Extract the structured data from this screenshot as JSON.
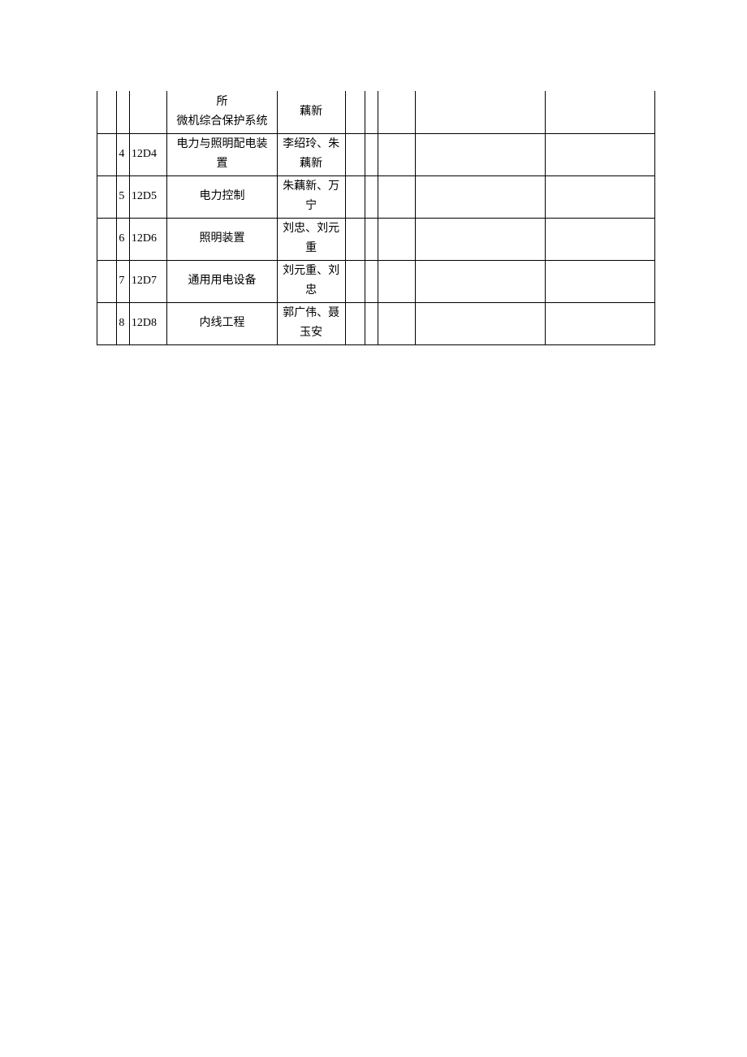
{
  "rows": [
    {
      "idx": "",
      "code": "",
      "name_line1": "所",
      "name_line2": "微机综合保护系统",
      "people": "藕新"
    },
    {
      "idx": "4",
      "code": "12D4",
      "name_line1": "电力与照明配电装",
      "name_line2": "置",
      "people": "李绍玲、朱藕新"
    },
    {
      "idx": "5",
      "code": "12D5",
      "name_line1": "电力控制",
      "name_line2": "",
      "people": "朱藕新、万宁"
    },
    {
      "idx": "6",
      "code": "12D6",
      "name_line1": "照明装置",
      "name_line2": "",
      "people": "刘忠、刘元重"
    },
    {
      "idx": "7",
      "code": "12D7",
      "name_line1": "通用用电设备",
      "name_line2": "",
      "people": "刘元重、刘忠"
    },
    {
      "idx": "8",
      "code": "12D8",
      "name_line1": "内线工程",
      "name_line2": "",
      "people": "郭广伟、聂玉安"
    }
  ]
}
